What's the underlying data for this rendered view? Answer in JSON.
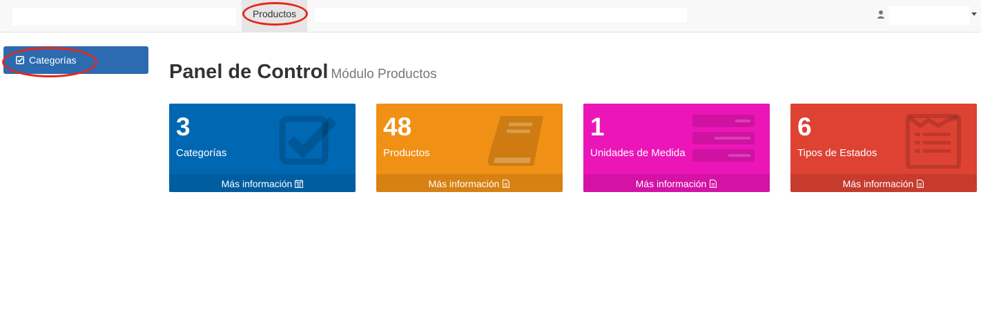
{
  "navbar": {
    "active_tab_label": "Productos"
  },
  "sidebar": {
    "items": [
      {
        "label": "Categorías",
        "icon": "check-square-icon"
      }
    ]
  },
  "header": {
    "title": "Panel de Control",
    "subtitle": "Módulo Productos"
  },
  "boxes": [
    {
      "value": "3",
      "label": "Categorías",
      "footer": "Más información",
      "color": "#0068b3",
      "icon": "check-square-icon",
      "footer_icon": "calendar-icon"
    },
    {
      "value": "48",
      "label": "Productos",
      "footer": "Más información",
      "color": "#f09015",
      "icon": "book-icon",
      "footer_icon": "file-icon"
    },
    {
      "value": "1",
      "label": "Unidades de Medida",
      "footer": "Más información",
      "color": "#ec15b8",
      "icon": "list-icon",
      "footer_icon": "file-icon"
    },
    {
      "value": "6",
      "label": "Tipos de Estados",
      "footer": "Más información",
      "color": "#dd4233",
      "icon": "envelope-list-icon",
      "footer_icon": "file-icon"
    }
  ],
  "colors": {
    "sidebar_active": "#2c6bb0",
    "annotation_red": "#e8261b"
  }
}
